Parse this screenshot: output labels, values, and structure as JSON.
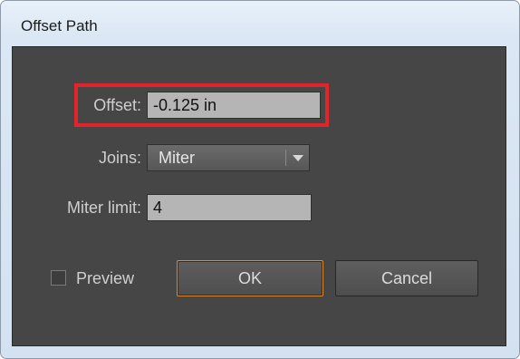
{
  "window": {
    "title": "Offset Path"
  },
  "form": {
    "offset_label": "Offset:",
    "offset_value": "-0.125 in",
    "joins_label": "Joins:",
    "joins_value": "Miter",
    "miter_limit_label": "Miter limit:",
    "miter_limit_value": "4"
  },
  "preview": {
    "label": "Preview",
    "checked": false
  },
  "buttons": {
    "ok_label": "OK",
    "cancel_label": "Cancel"
  },
  "colors": {
    "highlight": "#e3242b",
    "primary_button_border": "#e08a2c",
    "dialog_background": "#464646"
  }
}
